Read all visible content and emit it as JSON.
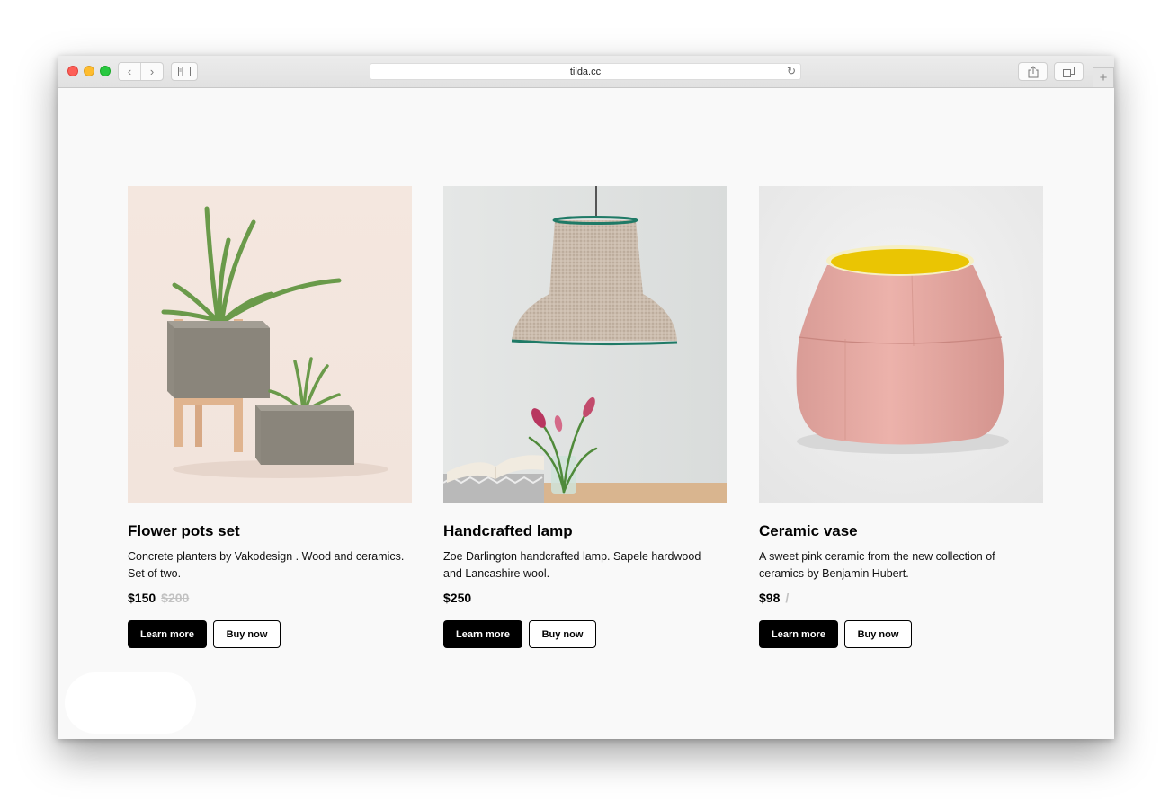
{
  "browser": {
    "url": "tilda.cc",
    "back_glyph": "‹",
    "forward_glyph": "›",
    "reload_glyph": "↻",
    "new_tab_glyph": "+"
  },
  "products": [
    {
      "title": "Flower pots set",
      "description": "Concrete planters by Vakodesign . Wood and ceramics. Set of two.",
      "price": "$150",
      "old_price": "$200",
      "learn_label": "Learn more",
      "buy_label": "Buy now",
      "image": "flower-pots-photo"
    },
    {
      "title": "Handcrafted lamp",
      "description": "Zoe Darlington handcrafted lamp. Sapele hardwood and Lancashire wool.",
      "price": "$250",
      "old_price": "",
      "learn_label": "Learn more",
      "buy_label": "Buy now",
      "image": "pendant-lamp-photo"
    },
    {
      "title": "Ceramic vase",
      "description": "A sweet pink ceramic from the new collection of ceramics by Benjamin Hubert.",
      "price": "$98",
      "old_price": "/",
      "learn_label": "Learn more",
      "buy_label": "Buy now",
      "image": "pink-vase-photo"
    }
  ],
  "colors": {
    "page_bg": "#f9f9f9",
    "button_primary": "#000000",
    "old_price": "#c2c2c2"
  }
}
